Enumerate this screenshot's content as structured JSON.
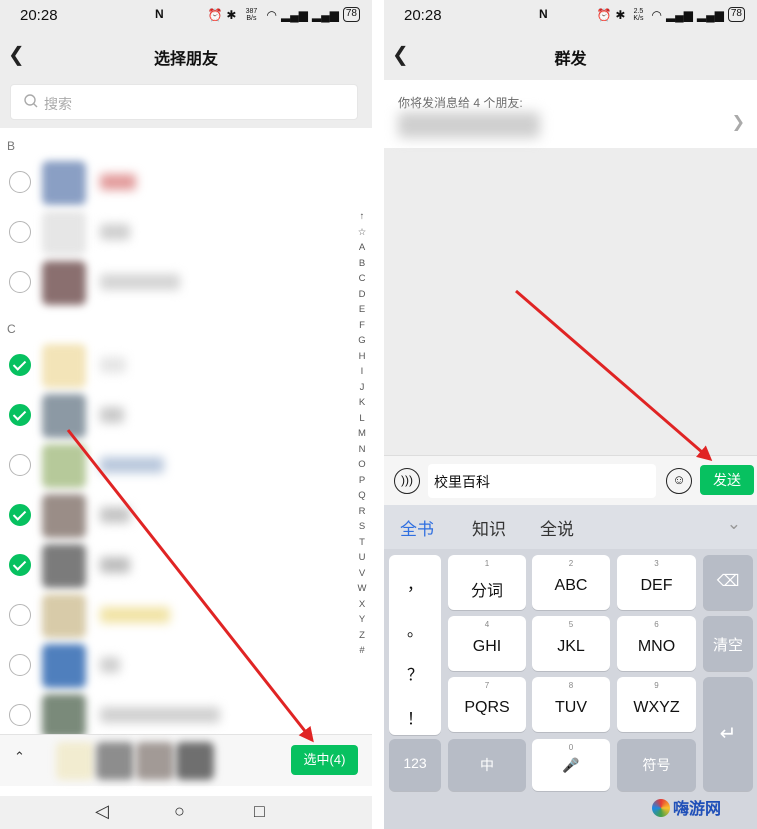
{
  "status_left": {
    "time": "20:28",
    "net_speed": "387 B/s",
    "battery": "78"
  },
  "status_right": {
    "time": "20:28",
    "net_speed": "2.5 K/s",
    "battery": "78"
  },
  "left": {
    "title": "选择朋友",
    "search_placeholder": "搜索",
    "sections": [
      "B",
      "C"
    ],
    "contacts": [
      {
        "checked": false,
        "avatar": "#8a9fc4",
        "name_color": "#e29a9a",
        "name_w": 36
      },
      {
        "checked": false,
        "avatar": "#e6e6e6",
        "name_color": "#cfcfcf",
        "name_w": 30
      },
      {
        "checked": false,
        "avatar": "#8a6f6f",
        "name_color": "#d4d4d4",
        "name_w": 80
      },
      {
        "checked": true,
        "avatar": "#f3e4b8",
        "name_color": "#e5e5e5",
        "name_w": 26
      },
      {
        "checked": true,
        "avatar": "#8c99a4",
        "name_color": "#c9c9c9",
        "name_w": 24
      },
      {
        "checked": false,
        "avatar": "#b6c99a",
        "name_color": "#b8c7dc",
        "name_w": 64
      },
      {
        "checked": true,
        "avatar": "#9a8d87",
        "name_color": "#c4c4c4",
        "name_w": 30
      },
      {
        "checked": true,
        "avatar": "#7b7b7b",
        "name_color": "#bdbdbd",
        "name_w": 30
      },
      {
        "checked": false,
        "avatar": "#d8cba9",
        "name_color": "#f1e3a4",
        "name_w": 70
      },
      {
        "checked": false,
        "avatar": "#4f7fbd",
        "name_color": "#cfcfcf",
        "name_w": 20
      },
      {
        "checked": false,
        "avatar": "#7a8a7a",
        "name_color": "#d0d0d0",
        "name_w": 120
      }
    ],
    "index": [
      "↑",
      "☆",
      "A",
      "B",
      "C",
      "D",
      "E",
      "F",
      "G",
      "H",
      "I",
      "J",
      "K",
      "L",
      "M",
      "N",
      "O",
      "P",
      "Q",
      "R",
      "S",
      "T",
      "U",
      "V",
      "W",
      "X",
      "Y",
      "Z",
      "#"
    ],
    "select_button": "选中(4)",
    "selected_avatars": [
      "#f2ecd0",
      "#8d8d8d",
      "#a29a96",
      "#6f6f6f"
    ]
  },
  "right": {
    "title": "群发",
    "recipients_label": "你将发消息给 4 个朋友:",
    "message_text": "校里百科",
    "send_button": "发送",
    "kb_tabs": [
      "全书",
      "知识",
      "全说"
    ],
    "punct": [
      "，",
      "。",
      "？",
      "！"
    ],
    "keys": [
      {
        "num": "1",
        "label": "分词"
      },
      {
        "num": "2",
        "label": "ABC"
      },
      {
        "num": "3",
        "label": "DEF"
      },
      {
        "num": "4",
        "label": "GHI"
      },
      {
        "num": "5",
        "label": "JKL"
      },
      {
        "num": "6",
        "label": "MNO"
      },
      {
        "num": "7",
        "label": "PQRS"
      },
      {
        "num": "8",
        "label": "TUV"
      },
      {
        "num": "9",
        "label": "WXYZ"
      }
    ],
    "clear_key": "清空",
    "bottom_keys": {
      "num": "123",
      "lang": "中",
      "space_num": "0",
      "symbol": "符号"
    }
  },
  "watermark": "嗨游网",
  "colors": {
    "accent": "#07c160",
    "arrow": "#e02424",
    "tab_active": "#2f6fe0"
  }
}
